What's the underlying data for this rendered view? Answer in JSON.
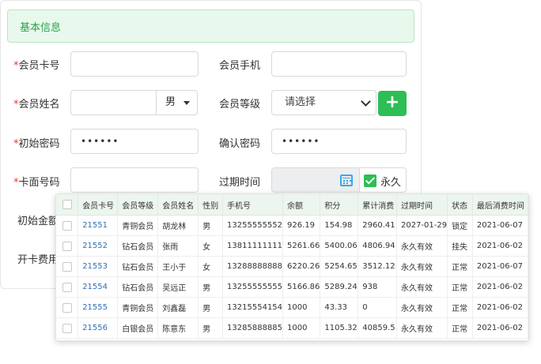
{
  "section": {
    "title": "基本信息"
  },
  "form": {
    "required_mark": "*",
    "card_no": {
      "label": "会员卡号"
    },
    "phone": {
      "label": "会员手机"
    },
    "name": {
      "label": "会员姓名"
    },
    "gender": {
      "value": "男"
    },
    "level": {
      "label": "会员等级",
      "placeholder": "请选择"
    },
    "plus_label": "+",
    "init_pwd": {
      "label": "初始密码",
      "value": "••••••"
    },
    "confirm_pwd": {
      "label": "确认密码",
      "value": "••••••"
    },
    "face_no": {
      "label": "卡面号码"
    },
    "expire": {
      "label": "过期时间",
      "forever_label": "永久",
      "forever_checked": true
    },
    "init_amount": {
      "label": "初始金额"
    },
    "open_fee": {
      "label": "开卡费用"
    }
  },
  "table": {
    "columns": [
      "",
      "会员卡号",
      "会员等级",
      "会员姓名",
      "性别",
      "手机号",
      "余额",
      "积分",
      "累计消费",
      "过期时间",
      "状态",
      "最后消费时间"
    ],
    "rows": [
      [
        "",
        "21551",
        "青铜会员",
        "胡龙林",
        "男",
        "13255555552",
        "926.19",
        "154.98",
        "2960.41",
        "2027-01-29",
        "锁定",
        "2021-06-07"
      ],
      [
        "",
        "21552",
        "钻石会员",
        "张雨",
        "女",
        "13811111111",
        "5261.66",
        "5400.06",
        "4806.94",
        "永久有效",
        "挂失",
        "2021-06-02"
      ],
      [
        "",
        "21553",
        "钻石会员",
        "王小于",
        "女",
        "13288888888",
        "6220.26",
        "5254.65",
        "3512.12",
        "永久有效",
        "正常",
        "2021-06-07"
      ],
      [
        "",
        "21554",
        "钻石会员",
        "吴远正",
        "男",
        "13255555555",
        "5166.86",
        "5289.24",
        "938",
        "永久有效",
        "正常",
        "2021-06-02"
      ],
      [
        "",
        "21555",
        "青铜会员",
        "刘鑫磊",
        "男",
        "13215554154",
        "1000",
        "43.33",
        "0",
        "永久有效",
        "正常",
        "2021-06-02"
      ],
      [
        "",
        "21556",
        "白银会员",
        "陈意东",
        "男",
        "13285888885",
        "1000",
        "1105.32",
        "40859.5",
        "永久有效",
        "正常",
        "2021-06-02"
      ]
    ]
  }
}
